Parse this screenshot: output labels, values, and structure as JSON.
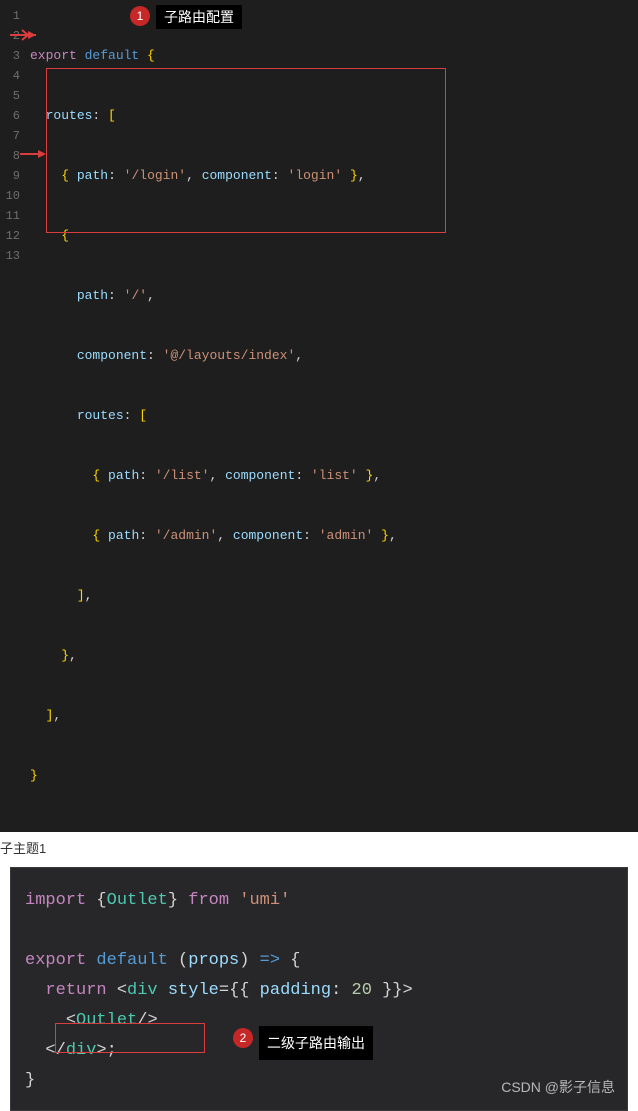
{
  "annotations": {
    "badge1": "1",
    "label1": "子路由配置",
    "badge2": "2",
    "label2": "二级子路由输出"
  },
  "subtitle": "子主题1",
  "watermark": "CSDN @影子信息",
  "code1": {
    "line_numbers": [
      "1",
      "2",
      "3",
      "4",
      "5",
      "6",
      "7",
      "8",
      "9",
      "10",
      "11",
      "12",
      "13"
    ],
    "l1": {
      "export": "export",
      "default": "default",
      "brace": "{"
    },
    "l2": {
      "routes": "routes",
      "colon": ":",
      "bracket": "["
    },
    "l3": {
      "brace_o": "{",
      "path_k": "path",
      "path_v": "'/login'",
      "comp_k": "component",
      "comp_v": "'login'",
      "brace_c": "}",
      "comma": ","
    },
    "l4": {
      "brace": "{"
    },
    "l5": {
      "path_k": "path",
      "path_v": "'/'"
    },
    "l6": {
      "comp_k": "component",
      "comp_v": "'@/layouts/index'"
    },
    "l7": {
      "routes": "routes",
      "bracket": "["
    },
    "l8": {
      "brace_o": "{",
      "path_k": "path",
      "path_v": "'/list'",
      "comp_k": "component",
      "comp_v": "'list'",
      "brace_c": "}",
      "comma": ","
    },
    "l9": {
      "brace_o": "{",
      "path_k": "path",
      "path_v": "'/admin'",
      "comp_k": "component",
      "comp_v": "'admin'",
      "brace_c": "}",
      "comma": ","
    },
    "l10": {
      "bracket": "]",
      "comma": ","
    },
    "l11": {
      "brace": "}",
      "comma": ","
    },
    "l12": {
      "bracket": "]",
      "comma": ","
    },
    "l13": {
      "brace": "}"
    }
  },
  "code2": {
    "l1": {
      "import": "import",
      "brace_o": "{",
      "outlet": "Outlet",
      "brace_c": "}",
      "from": "from",
      "umi": "'umi'"
    },
    "l2": {
      "export": "export",
      "default": "default",
      "paren_o": "(",
      "props": "props",
      "paren_c": ")",
      "arrow": "=>",
      "brace": "{"
    },
    "l3": {
      "return": "return",
      "lt": "<",
      "div": "div",
      "style": "style",
      "eq": "=",
      "oo": "{{",
      "padding": "padding",
      "colon": ":",
      "num": "20",
      "cc": "}}",
      "gt": ">"
    },
    "l4": {
      "lt": "<",
      "outlet": "Outlet",
      "slash": "/",
      "gt": ">"
    },
    "l5": {
      "lt": "<",
      "slash": "/",
      "div": "div",
      "gt": ">",
      "semi": ";"
    },
    "l6": {
      "brace": "}"
    }
  }
}
